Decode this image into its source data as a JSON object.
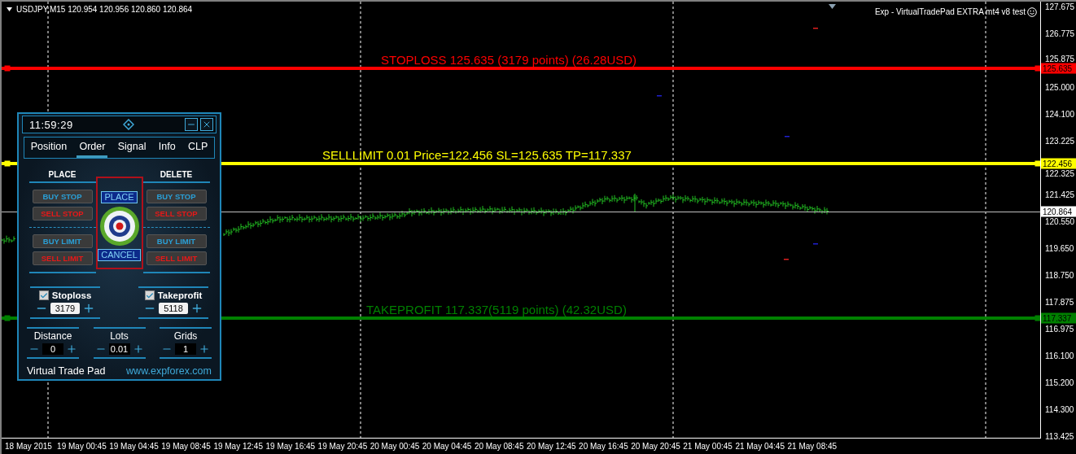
{
  "chart": {
    "symbol_header": "USDJPY,M15  120.954 120.956 120.860 120.864",
    "expert_label": "Exp - VirtualTradePad EXTRA mt4 v8 test",
    "price_ticks": [
      "127.675",
      "126.775",
      "125.875",
      "125.000",
      "124.100",
      "123.225",
      "122.325",
      "121.425",
      "120.550",
      "119.650",
      "118.750",
      "117.875",
      "116.975",
      "116.100",
      "115.200",
      "114.300",
      "113.425"
    ],
    "time_labels": [
      "18 May 2015",
      "19 May 00:45",
      "19 May 04:45",
      "19 May 08:45",
      "19 May 12:45",
      "19 May 16:45",
      "19 May 20:45",
      "20 May 00:45",
      "20 May 04:45",
      "20 May 08:45",
      "20 May 12:45",
      "20 May 16:45",
      "20 May 20:45",
      "21 May 00:45",
      "21 May 04:45",
      "21 May 08:45"
    ],
    "lines": [
      {
        "kind": "stoploss",
        "label": "STOPLOSS 125.635 (3179 points) (26.28USD)",
        "price": "125.635",
        "color": "#ff0000"
      },
      {
        "kind": "order",
        "label": "SELLLIMIT 0.01 Price=122.456 SL=125.635 TP=117.337",
        "price": "122.456",
        "color": "#ffff00"
      },
      {
        "kind": "bid",
        "price": "120.864",
        "color": "#c0c0c0"
      },
      {
        "kind": "takeprofit",
        "label": "TAKEPROFIT 117.337(5119 points) (42.32USD)",
        "price": "117.337",
        "color": "#008000"
      }
    ]
  },
  "panel": {
    "clock": "11:59:29",
    "tabs": [
      {
        "label": "Position",
        "selected": false
      },
      {
        "label": "Order",
        "selected": true
      },
      {
        "label": "Signal",
        "selected": false
      },
      {
        "label": "Info",
        "selected": false
      },
      {
        "label": "CLP",
        "selected": false
      }
    ],
    "place_heading": "PLACE",
    "delete_heading": "DELETE",
    "place_buttons": [
      {
        "label": "BUY STOP",
        "kind": "buy"
      },
      {
        "label": "SELL STOP",
        "kind": "sell"
      },
      {
        "label": "BUY LIMIT",
        "kind": "buy"
      },
      {
        "label": "SELL LIMIT",
        "kind": "sell"
      }
    ],
    "delete_buttons": [
      {
        "label": "BUY STOP",
        "kind": "buy"
      },
      {
        "label": "SELL STOP",
        "kind": "sell"
      },
      {
        "label": "BUY LIMIT",
        "kind": "buy"
      },
      {
        "label": "SELL LIMIT",
        "kind": "sell"
      }
    ],
    "center_buttons": [
      "PLACE",
      "CANCEL"
    ],
    "stoploss": {
      "label": "Stoploss",
      "checked": true,
      "value": "3179"
    },
    "takeprofit": {
      "label": "Takeprofit",
      "checked": true,
      "value": "5118"
    },
    "steppers": [
      {
        "label": "Distance",
        "value": "0"
      },
      {
        "label": "Lots",
        "value": "0.01"
      },
      {
        "label": "Grids",
        "value": "1"
      }
    ],
    "footer_title": "Virtual Trade Pad",
    "footer_link": "www.expforex.com"
  }
}
